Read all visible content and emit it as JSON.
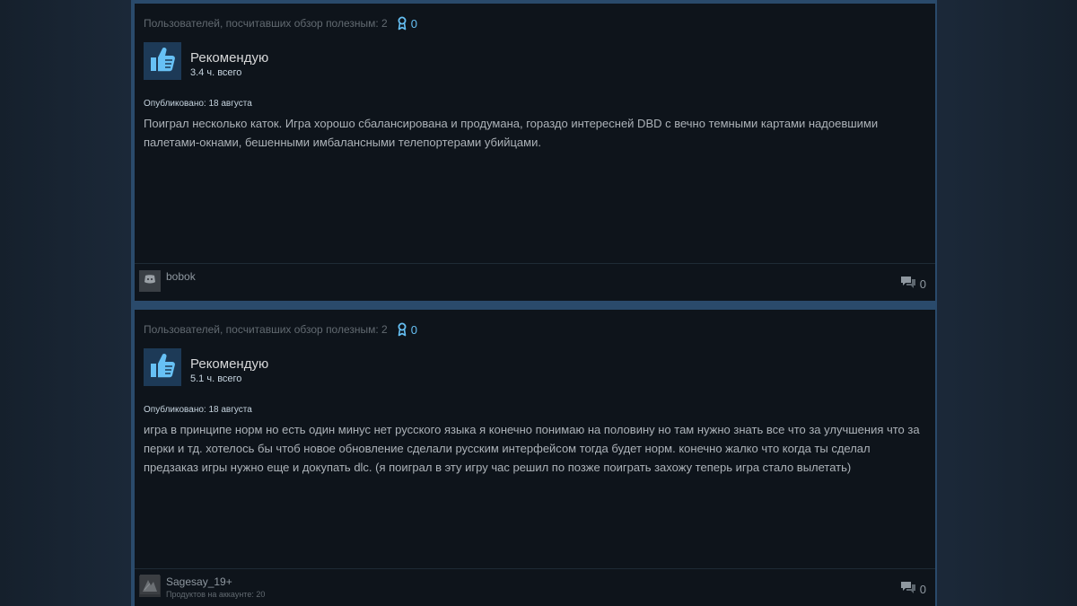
{
  "reviews": [
    {
      "helpful_text": "Пользователей, посчитавших обзор полезным: 2",
      "award_count": "0",
      "vote_label": "Рекомендую",
      "hours": "3.4 ч. всего",
      "posted": "Опубликовано: 18 августа",
      "body": "Поиграл несколько каток. Игра хорошо сбалансирована и продумана, гораздо интересней DBD с вечно темными картами надоевшими палетами-окнами, бешенными имбалансными телепортерами убийцами.",
      "author": "bobok",
      "products": "",
      "comment_count": "0"
    },
    {
      "helpful_text": "Пользователей, посчитавших обзор полезным: 2",
      "award_count": "0",
      "vote_label": "Рекомендую",
      "hours": "5.1 ч. всего",
      "posted": "Опубликовано: 18 августа",
      "body": "игра в принципе норм но есть один минус нет русского языка я конечно понимаю на половину но там нужно знать все что за улучшения что за перки и тд. хотелось бы чтоб новое обновление сделали русским интерфейсом тогда будет норм. конечно жалко что когда ты сделал предзаказ игры нужно еще и докупать dlc. (я поиграл в эту игру час решил по позже поиграть захожу теперь игра стало вылетать)",
      "author": "Sagesay_19+",
      "products": "Продуктов на аккаунте: 20",
      "comment_count": "0"
    }
  ],
  "colors": {
    "background": "#1b2838",
    "card": "#0e141b",
    "accent": "#66c0f4",
    "thumb_bg": "#1d3a57"
  },
  "icons": {
    "vote": "thumbs-up-icon",
    "award": "award-icon",
    "comment": "comment-icon",
    "avatar_default": "discord-icon"
  }
}
